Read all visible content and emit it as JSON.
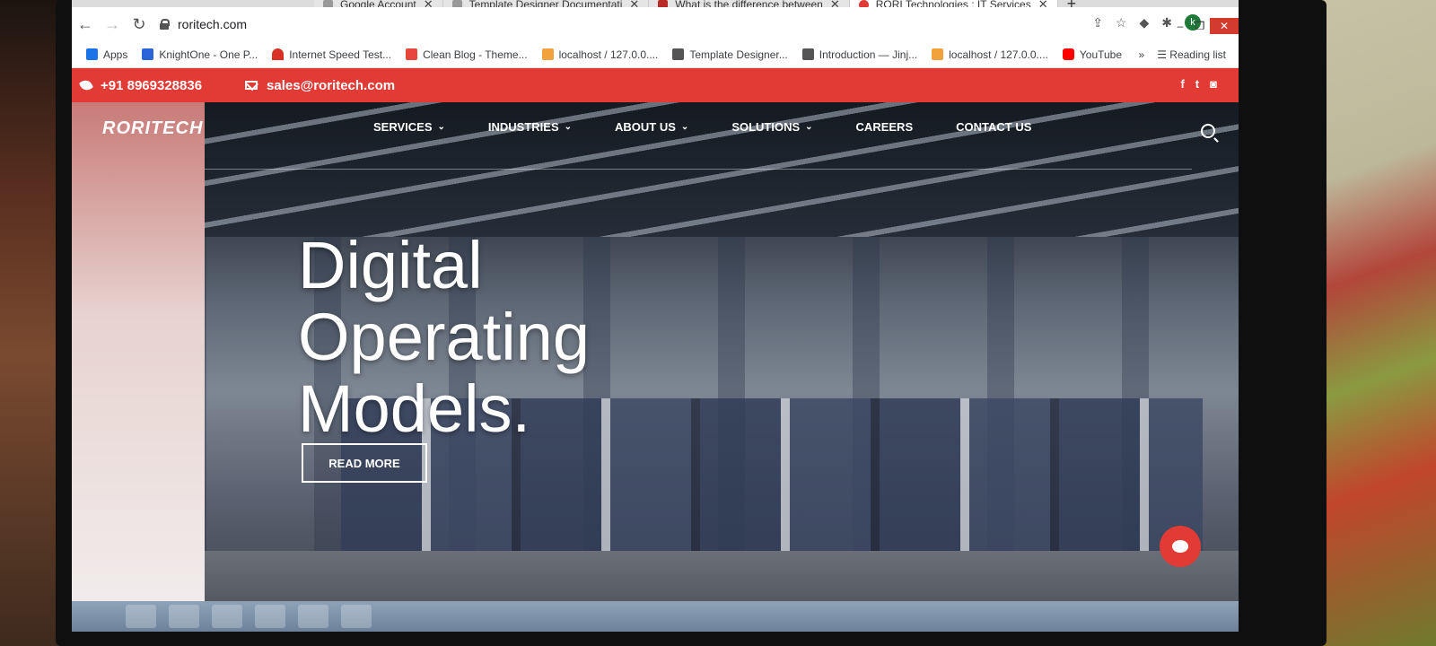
{
  "browser": {
    "tabs": [
      {
        "title": "Google Account"
      },
      {
        "title": "Template Designer Documentati"
      },
      {
        "title": "What is the difference between"
      },
      {
        "title": "RORI Technologies : IT Services"
      }
    ],
    "url": "roritech.com",
    "bookmarks": [
      {
        "label": "Apps",
        "color": "#1a73e8"
      },
      {
        "label": "KnightOne - One P...",
        "color": "#2b63d9"
      },
      {
        "label": "Internet Speed Test...",
        "color": "#d93025"
      },
      {
        "label": "Clean Blog - Theme...",
        "color": "#e8453c"
      },
      {
        "label": "localhost / 127.0.0....",
        "color": "#f2a23c"
      },
      {
        "label": "Template Designer...",
        "color": "#555555"
      },
      {
        "label": "Introduction — Jinj...",
        "color": "#555555"
      },
      {
        "label": "localhost / 127.0.0....",
        "color": "#f2a23c"
      },
      {
        "label": "YouTube",
        "color": "#ff0000"
      }
    ],
    "more_bookmarks": "»",
    "reading_list": "Reading list",
    "profile_initial": "k"
  },
  "site": {
    "phone": "+91 8969328836",
    "email": "sales@roritech.com",
    "logo": "RORITECH",
    "nav": [
      {
        "label": "SERVICES",
        "dropdown": true
      },
      {
        "label": "INDUSTRIES",
        "dropdown": true
      },
      {
        "label": "ABOUT US",
        "dropdown": true
      },
      {
        "label": "SOLUTIONS",
        "dropdown": true
      },
      {
        "label": "CAREERS",
        "dropdown": false
      },
      {
        "label": "CONTACT US",
        "dropdown": false
      }
    ],
    "headline_lines": [
      "Digital",
      "Operating",
      "Models."
    ],
    "cta": "READ MORE",
    "accent": "#e23b35"
  }
}
